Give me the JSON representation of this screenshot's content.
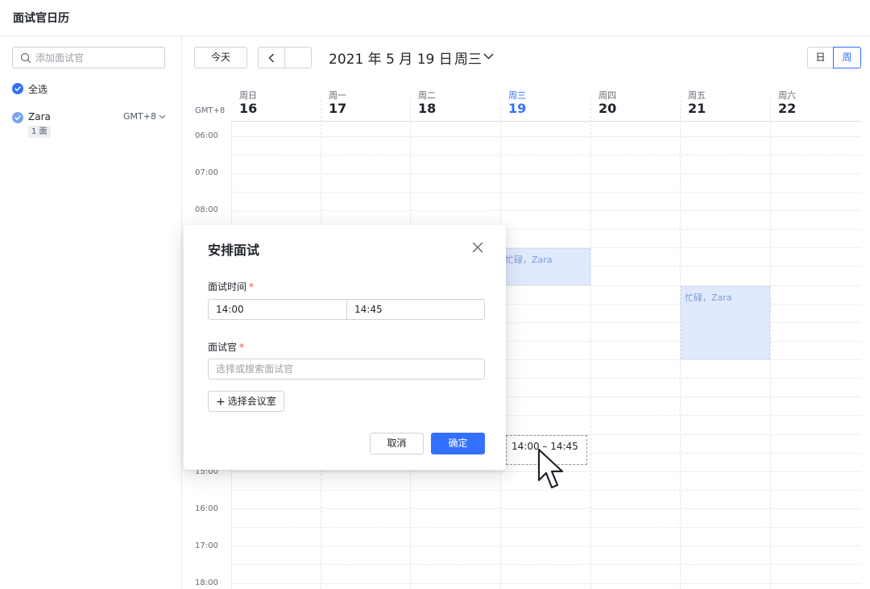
{
  "app": {
    "title": "面试官日历"
  },
  "sidebar": {
    "search_placeholder": "添加面试官",
    "select_all_label": "全选",
    "interviewers": [
      {
        "name": "Zara",
        "timezone": "GMT+8",
        "count_badge": "1 面"
      }
    ]
  },
  "toolbar": {
    "today_label": "今天",
    "date_title": "2021 年 5 月 19 日",
    "weekday_title": "周三",
    "view_day_label": "日",
    "view_week_label": "周",
    "active_view": "周"
  },
  "calendar": {
    "timezone_label": "GMT+8",
    "days": [
      {
        "dow": "周日",
        "num": "16"
      },
      {
        "dow": "周一",
        "num": "17"
      },
      {
        "dow": "周二",
        "num": "18"
      },
      {
        "dow": "周三",
        "num": "19",
        "today": true
      },
      {
        "dow": "周四",
        "num": "20"
      },
      {
        "dow": "周五",
        "num": "21"
      },
      {
        "dow": "周六",
        "num": "22"
      }
    ],
    "hours": [
      "06:00",
      "07:00",
      "08:00",
      "15:00",
      "16:00",
      "17:00",
      "18:00"
    ],
    "busy_events": [
      {
        "label": "忙碌，Zara",
        "day": "周三",
        "start": "09:00",
        "end": "10:00"
      },
      {
        "label": "忙碌，Zara",
        "day": "周五",
        "start": "10:00",
        "end": "12:00"
      }
    ],
    "selection": {
      "label": "14:00 – 14:45",
      "day": "周三"
    }
  },
  "modal": {
    "title": "安排面试",
    "time_label": "面试时间",
    "start_time": "14:00",
    "end_time": "14:45",
    "interviewer_label": "面试官",
    "interviewer_placeholder": "选择或搜索面试官",
    "room_button_label": "选择会议室",
    "cancel_label": "取消",
    "ok_label": "确定",
    "required_mark": "*"
  },
  "colors": {
    "accent": "#3370ff",
    "busy_fill": "#e1eafd",
    "busy_text": "#7b9ad7",
    "required": "#f54a45"
  },
  "icons": {
    "search": "search-icon",
    "check": "check-icon",
    "chevron": "chevron-down-icon",
    "prev": "chevron-left-icon",
    "close": "close-icon",
    "plus": "plus-icon",
    "cursor": "mouse-pointer-icon"
  }
}
